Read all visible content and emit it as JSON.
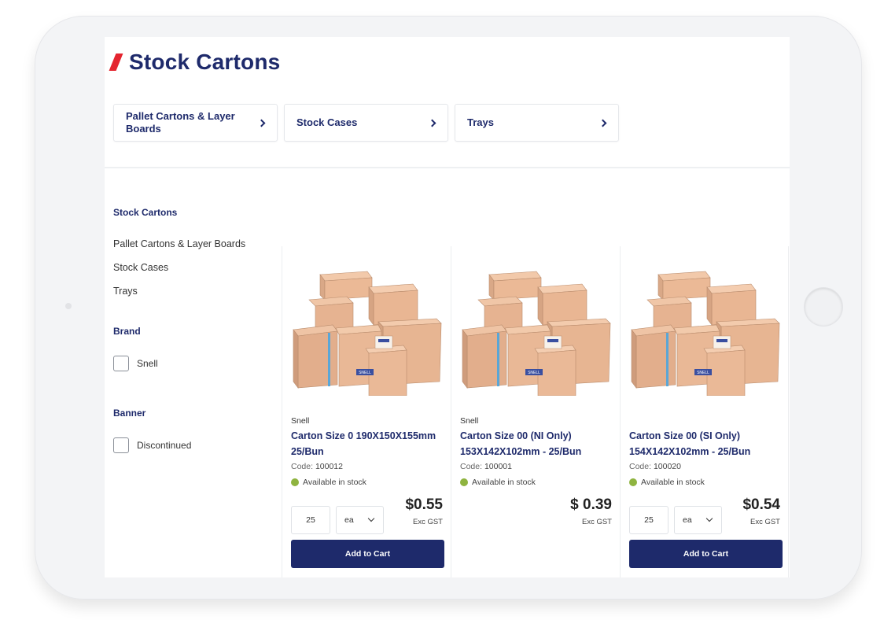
{
  "page": {
    "title": "Stock Cartons"
  },
  "category_cards": [
    {
      "label": "Pallet Cartons & Layer Boards"
    },
    {
      "label": "Stock Cases"
    },
    {
      "label": "Trays"
    }
  ],
  "sidebar": {
    "categories_heading": "Stock Cartons",
    "category_links": [
      "Pallet Cartons & Layer Boards",
      "Stock Cases",
      "Trays"
    ],
    "brand_heading": "Brand",
    "brand_option": "Snell",
    "banner_heading": "Banner",
    "banner_option": "Discontinued"
  },
  "products": [
    {
      "brand": "Snell",
      "name": "Carton Size 0 190X150X155mm 25/Bun",
      "code_label": "Code:",
      "code": "100012",
      "stock": "Available in stock",
      "qty": "25",
      "unit": "ea",
      "price": "$0.55",
      "gst": "Exc GST",
      "button": "Add to Cart",
      "has_controls": true
    },
    {
      "brand": "Snell",
      "name": "Carton Size 00 (NI Only) 153X142X102mm - 25/Bun",
      "code_label": "Code:",
      "code": "100001",
      "stock": "Available in stock",
      "price": "$ 0.39",
      "gst": "Exc GST",
      "has_controls": false
    },
    {
      "name": "Carton Size 00 (SI Only) 154X142X102mm - 25/Bun",
      "code_label": "Code:",
      "code": "100020",
      "stock": "Available in stock",
      "qty": "25",
      "unit": "ea",
      "price": "$0.54",
      "gst": "Exc GST",
      "button": "Add to Cart",
      "has_controls": true
    }
  ],
  "colors": {
    "brand_navy": "#1e2a6b",
    "accent_red": "#e4252f",
    "stock_green": "#8fb440"
  },
  "box_label": "SNELL"
}
